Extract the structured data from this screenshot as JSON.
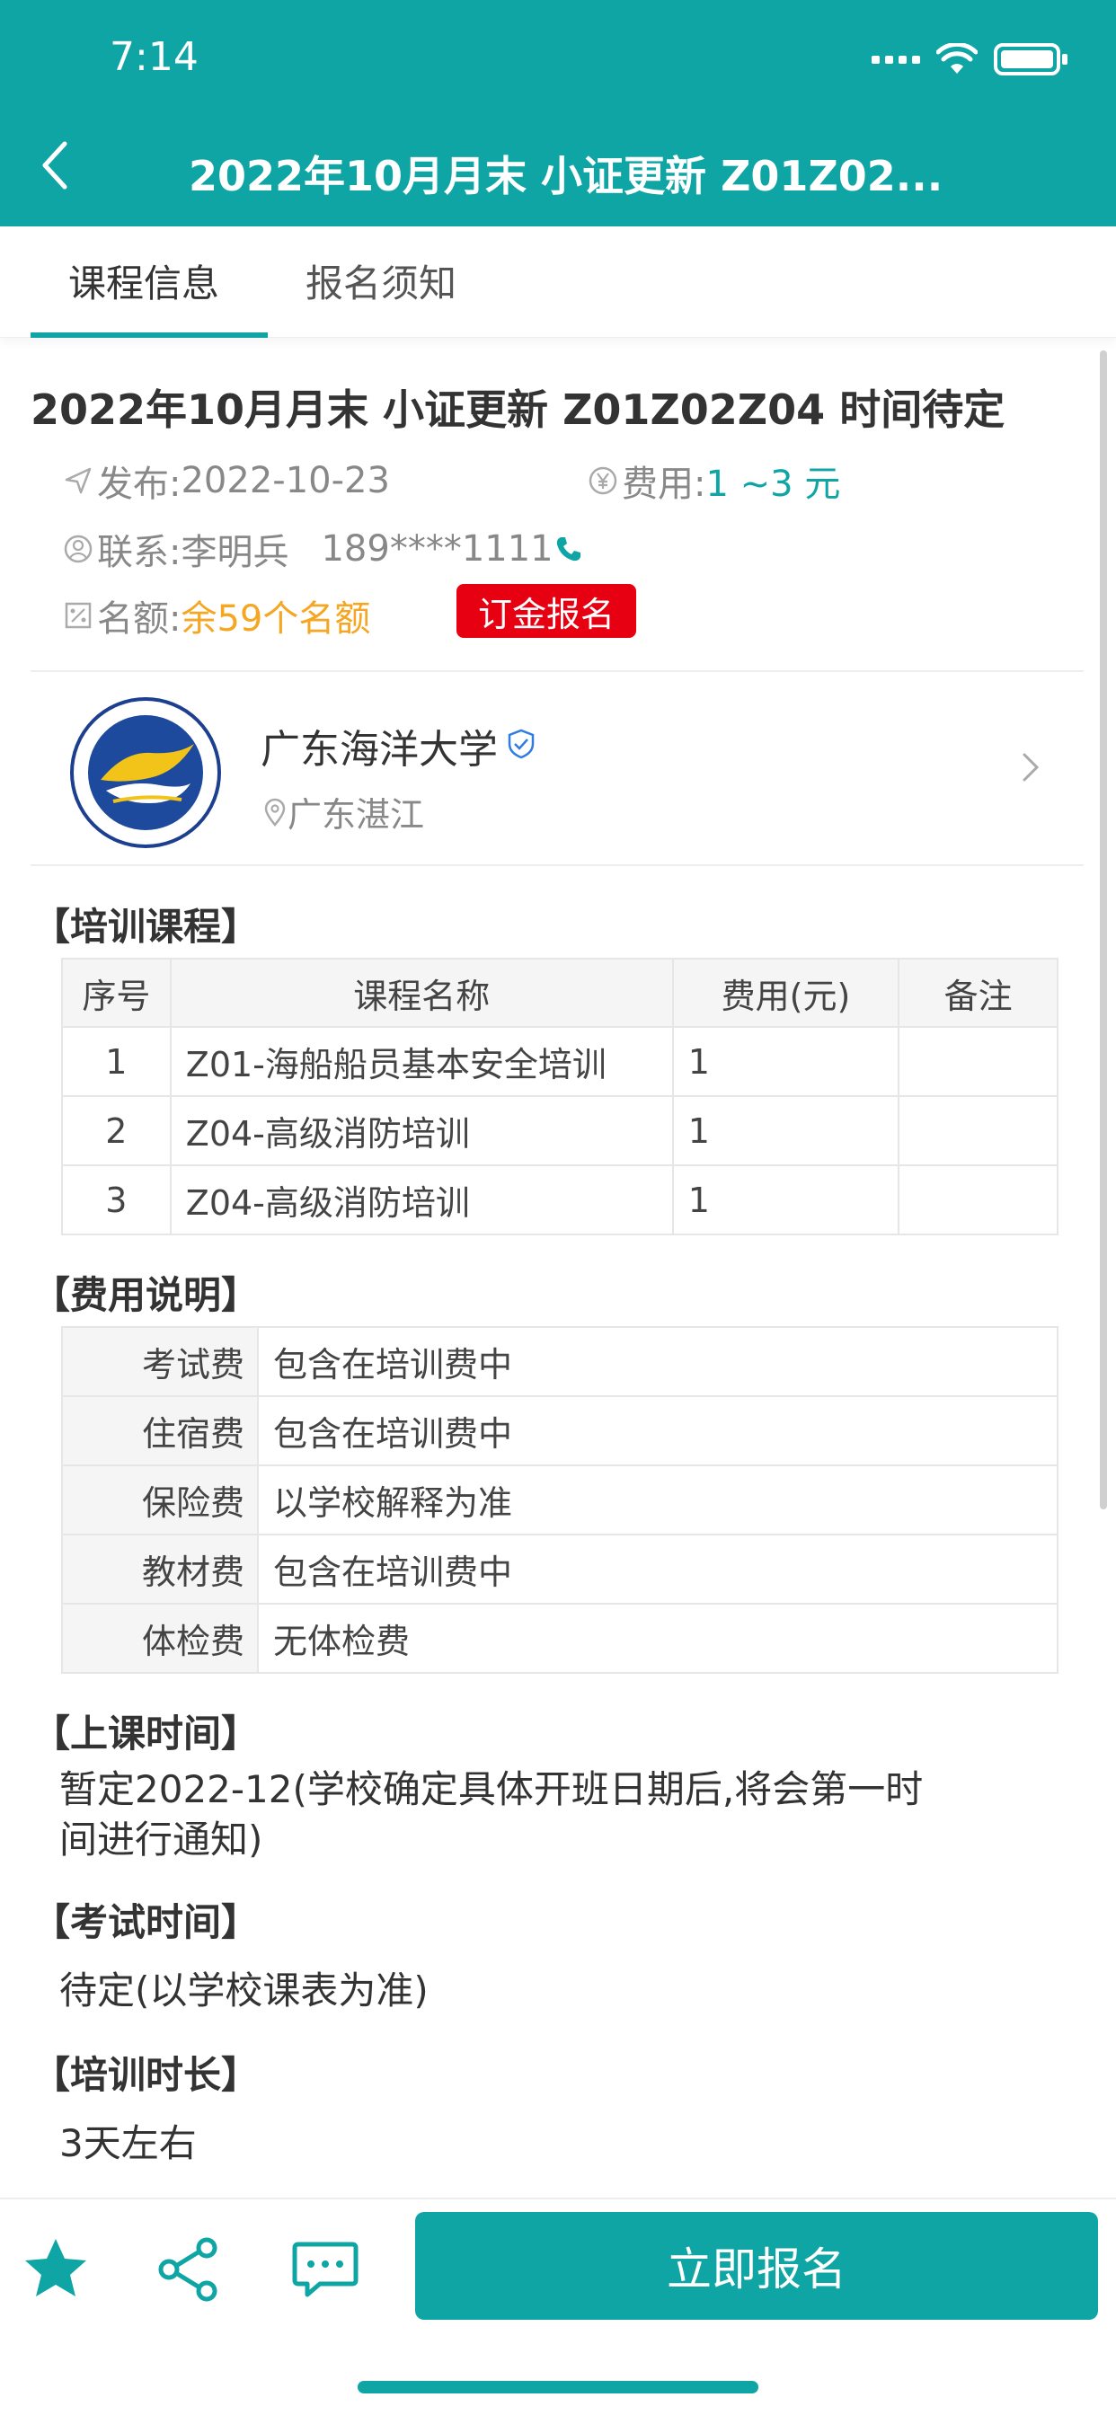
{
  "status_bar": {
    "time": "7:14"
  },
  "nav": {
    "title": "2022年10月月末 小证更新 Z01Z02..."
  },
  "tabs": [
    {
      "label": "课程信息"
    },
    {
      "label": "报名须知"
    }
  ],
  "course": {
    "title": "2022年10月月末 小证更新 Z01Z02Z04 时间待定",
    "publish_label": "发布:",
    "publish_date": "2022-10-23",
    "fee_label": "费用:",
    "fee_value": "1 ~3 元",
    "contact_label": "联系:",
    "contact_name": "李明兵",
    "contact_phone": "189****1111",
    "quota_label": "名额:",
    "quota_value": "余59个名额",
    "deposit_button": "订金报名"
  },
  "school": {
    "name": "广东海洋大学",
    "location": "广东湛江"
  },
  "sections": {
    "courses": "【培训课程】",
    "fees": "【费用说明】",
    "class_time": "【上课时间】",
    "exam_time": "【考试时间】",
    "duration": "【培训时长】"
  },
  "course_table": {
    "headers": [
      "序号",
      "课程名称",
      "费用(元)",
      "备注"
    ],
    "rows": [
      [
        "1",
        "Z01-海船船员基本安全培训",
        "1",
        ""
      ],
      [
        "2",
        "Z04-高级消防培训",
        "1",
        ""
      ],
      [
        "3",
        "Z04-高级消防培训",
        "1",
        ""
      ]
    ]
  },
  "fee_table": {
    "rows": [
      [
        "考试费",
        "包含在培训费中"
      ],
      [
        "住宿费",
        "包含在培训费中"
      ],
      [
        "保险费",
        "以学校解释为准"
      ],
      [
        "教材费",
        "包含在培训费中"
      ],
      [
        "体检费",
        "无体检费"
      ]
    ]
  },
  "class_time_text_line1": "暂定2022-12(学校确定具体开班日期后,将会第一时",
  "class_time_text_line2": "间进行通知)",
  "exam_time_text": "待定(以学校课表为准)",
  "duration_text": "3天左右",
  "bottom": {
    "signup_button": "立即报名"
  },
  "colors": {
    "primary": "#0fa5a4",
    "red": "#e60012",
    "orange": "#f5a623"
  },
  "icons": [
    "back-icon",
    "send-icon",
    "yen-icon",
    "user-icon",
    "phone-icon",
    "quota-icon",
    "verified-icon",
    "location-icon",
    "chevron-right-icon",
    "star-icon",
    "share-icon",
    "chat-icon"
  ]
}
